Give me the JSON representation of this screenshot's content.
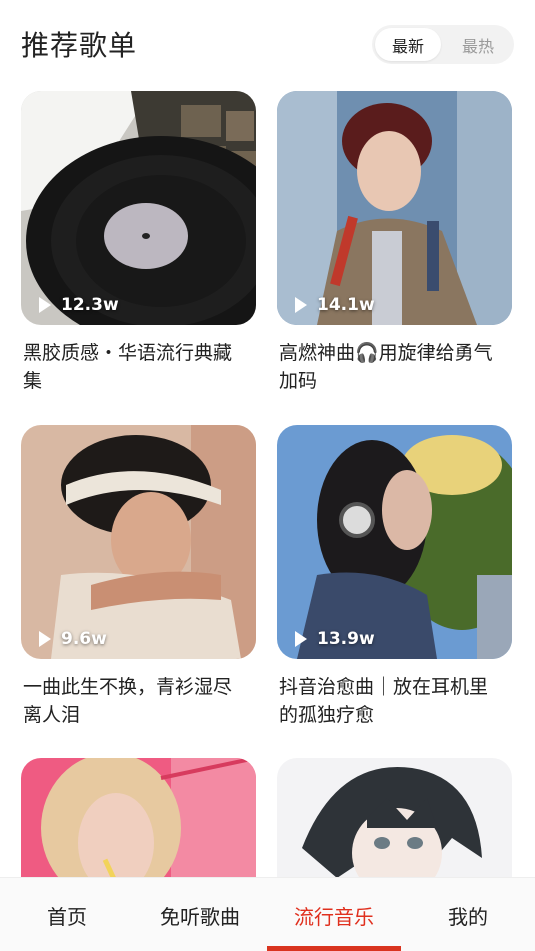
{
  "header": {
    "title": "推荐歌单",
    "sort_tabs": [
      {
        "label": "最新",
        "active": true
      },
      {
        "label": "最热",
        "active": false
      }
    ]
  },
  "playlists": [
    {
      "title": "黑胶质感・华语流行典藏集",
      "plays": "12.3w",
      "cover": "vinyl-record-image"
    },
    {
      "title": "高燃神曲🎧用旋律给勇气加码",
      "plays": "14.1w",
      "cover": "singer-with-microphone-image"
    },
    {
      "title": "一曲此生不换，青衫湿尽离人泪",
      "plays": "9.6w",
      "cover": "man-with-headband-image"
    },
    {
      "title": "抖音治愈曲｜放在耳机里的孤独疗愈",
      "plays": "13.9w",
      "cover": "girl-with-headphones-image"
    },
    {
      "title": "",
      "plays": "",
      "cover": "blonde-girl-pink-image"
    },
    {
      "title": "",
      "plays": "",
      "cover": "anime-boy-image"
    }
  ],
  "tabbar": {
    "tabs": [
      {
        "label": "首页",
        "active": false
      },
      {
        "label": "免听歌曲",
        "active": false
      },
      {
        "label": "流行音乐",
        "active": true
      },
      {
        "label": "我的",
        "active": false
      }
    ],
    "active_color": "#e0301e"
  }
}
